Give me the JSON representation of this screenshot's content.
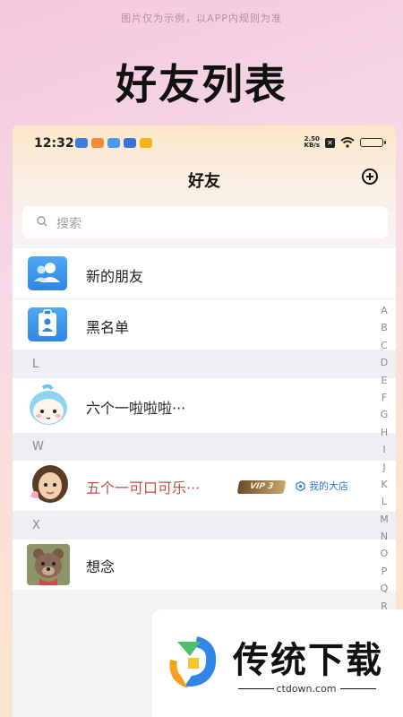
{
  "disclaimer": "图片仅为示例，以APP内规则为准",
  "promo_title": "好友列表",
  "status_bar": {
    "time": "12:32",
    "net_speed_value": "2.50",
    "net_speed_unit": "KB/s"
  },
  "nav": {
    "title": "好友"
  },
  "search": {
    "placeholder": "搜索"
  },
  "functions": [
    {
      "label": "新的朋友",
      "icon": "people-icon"
    },
    {
      "label": "黑名单",
      "icon": "contact-card-icon"
    }
  ],
  "sections": [
    {
      "letter": "L",
      "contacts": [
        {
          "name": "六个一啦啦啦···",
          "avatar": "cartoon-girl-avatar"
        }
      ]
    },
    {
      "letter": "W",
      "contacts": [
        {
          "name": "五个一可口可乐···",
          "avatar": "girl-avatar",
          "name_color": "#c0504d",
          "vip": "VIP 3",
          "shop": "我的大店"
        }
      ]
    },
    {
      "letter": "X",
      "contacts": [
        {
          "name": "想念",
          "avatar": "bear-avatar"
        }
      ]
    }
  ],
  "index_letters": [
    "A",
    "B",
    "C",
    "D",
    "E",
    "F",
    "G",
    "H",
    "I",
    "J",
    "K",
    "L",
    "M",
    "N",
    "O",
    "P",
    "Q",
    "R"
  ],
  "watermark": {
    "brand": "传统下载",
    "url": "ctdown.com"
  },
  "colors": {
    "accent_blue": "#2f86e6",
    "vip_red": "#c0504d"
  }
}
